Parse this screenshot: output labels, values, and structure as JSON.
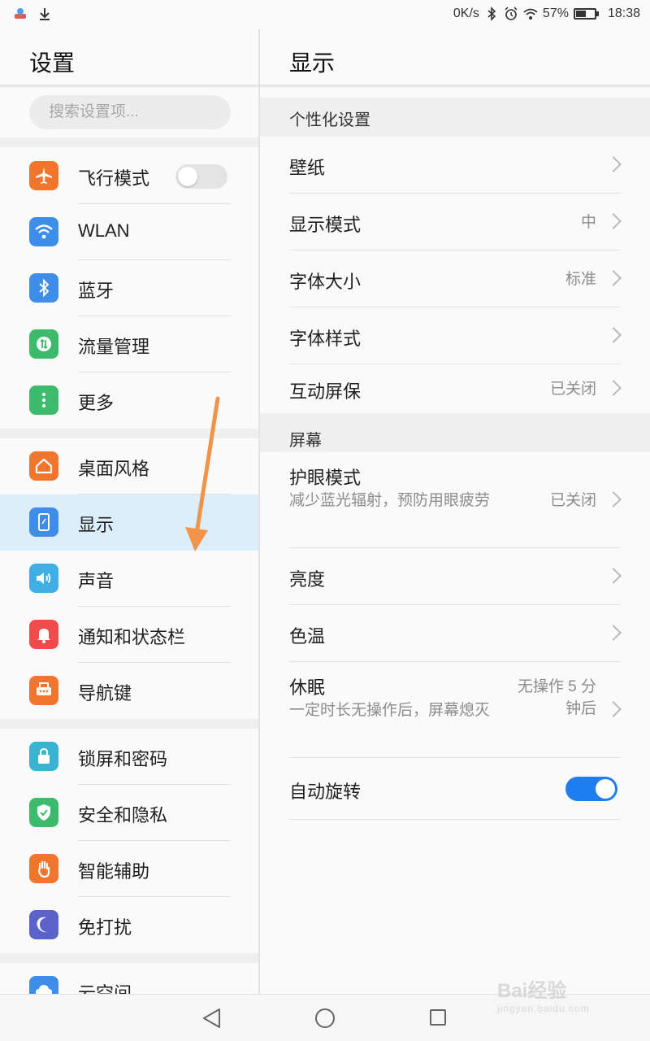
{
  "status_bar": {
    "speed": "0K/s",
    "battery_percent": "57%",
    "battery_level": 0.57,
    "time": "18:38",
    "icons": [
      "notification-app-icon",
      "download-icon",
      "bluetooth-icon",
      "alarm-icon",
      "wifi-icon",
      "battery-icon"
    ]
  },
  "left_pane": {
    "title": "设置",
    "search_placeholder": "搜索设置项...",
    "airplane_toggle_on": false,
    "items": [
      {
        "label": "飞行模式",
        "icon": "airplane-icon",
        "color": "#f2752d"
      },
      {
        "label": "WLAN",
        "icon": "wifi-icon",
        "color": "#3e8de8"
      },
      {
        "label": "蓝牙",
        "icon": "bluetooth-icon",
        "color": "#3e8de8"
      },
      {
        "label": "流量管理",
        "icon": "data-usage-icon",
        "color": "#3dba6c"
      },
      {
        "label": "更多",
        "icon": "more-icon",
        "color": "#3dba6c"
      },
      {
        "label": "桌面风格",
        "icon": "home-icon",
        "color": "#f2752d"
      },
      {
        "label": "显示",
        "icon": "display-icon",
        "color": "#3e8de8",
        "selected": true
      },
      {
        "label": "声音",
        "icon": "sound-icon",
        "color": "#3eaee5"
      },
      {
        "label": "通知和状态栏",
        "icon": "bell-icon",
        "color": "#f04a4a"
      },
      {
        "label": "导航键",
        "icon": "navigation-key-icon",
        "color": "#f2752d"
      },
      {
        "label": "锁屏和密码",
        "icon": "lock-icon",
        "color": "#39b3cf"
      },
      {
        "label": "安全和隐私",
        "icon": "shield-icon",
        "color": "#3dba6c"
      },
      {
        "label": "智能辅助",
        "icon": "hand-icon",
        "color": "#f2752d"
      },
      {
        "label": "免打扰",
        "icon": "moon-icon",
        "color": "#5b63c9"
      },
      {
        "label": "云空间",
        "icon": "cloud-icon",
        "color": "#3e8de8"
      }
    ]
  },
  "right_pane": {
    "title": "显示",
    "sections": [
      {
        "header": "个性化设置",
        "rows": [
          {
            "label": "壁纸",
            "value": ""
          },
          {
            "label": "显示模式",
            "value": "中"
          },
          {
            "label": "字体大小",
            "value": "标准"
          },
          {
            "label": "字体样式",
            "value": ""
          },
          {
            "label": "互动屏保",
            "value": "已关闭"
          }
        ]
      },
      {
        "header": "屏幕",
        "rows": [
          {
            "label": "护眼模式",
            "sub": "减少蓝光辐射，预防用眼疲劳",
            "value": "已关闭"
          },
          {
            "label": "亮度",
            "value": ""
          },
          {
            "label": "色温",
            "value": ""
          },
          {
            "label": "休眠",
            "sub": "一定时长无操作后，屏幕熄灭",
            "value": "无操作 5 分钟后"
          },
          {
            "label": "自动旋转",
            "toggle_on": true
          }
        ]
      }
    ]
  },
  "nav_bar": {
    "buttons": [
      "back-icon",
      "home-icon",
      "recents-icon"
    ]
  },
  "annotation": {
    "arrow_color": "#f0944a"
  },
  "watermark": {
    "text": "Bai经验",
    "sub": "jingyan.baidu.com"
  }
}
